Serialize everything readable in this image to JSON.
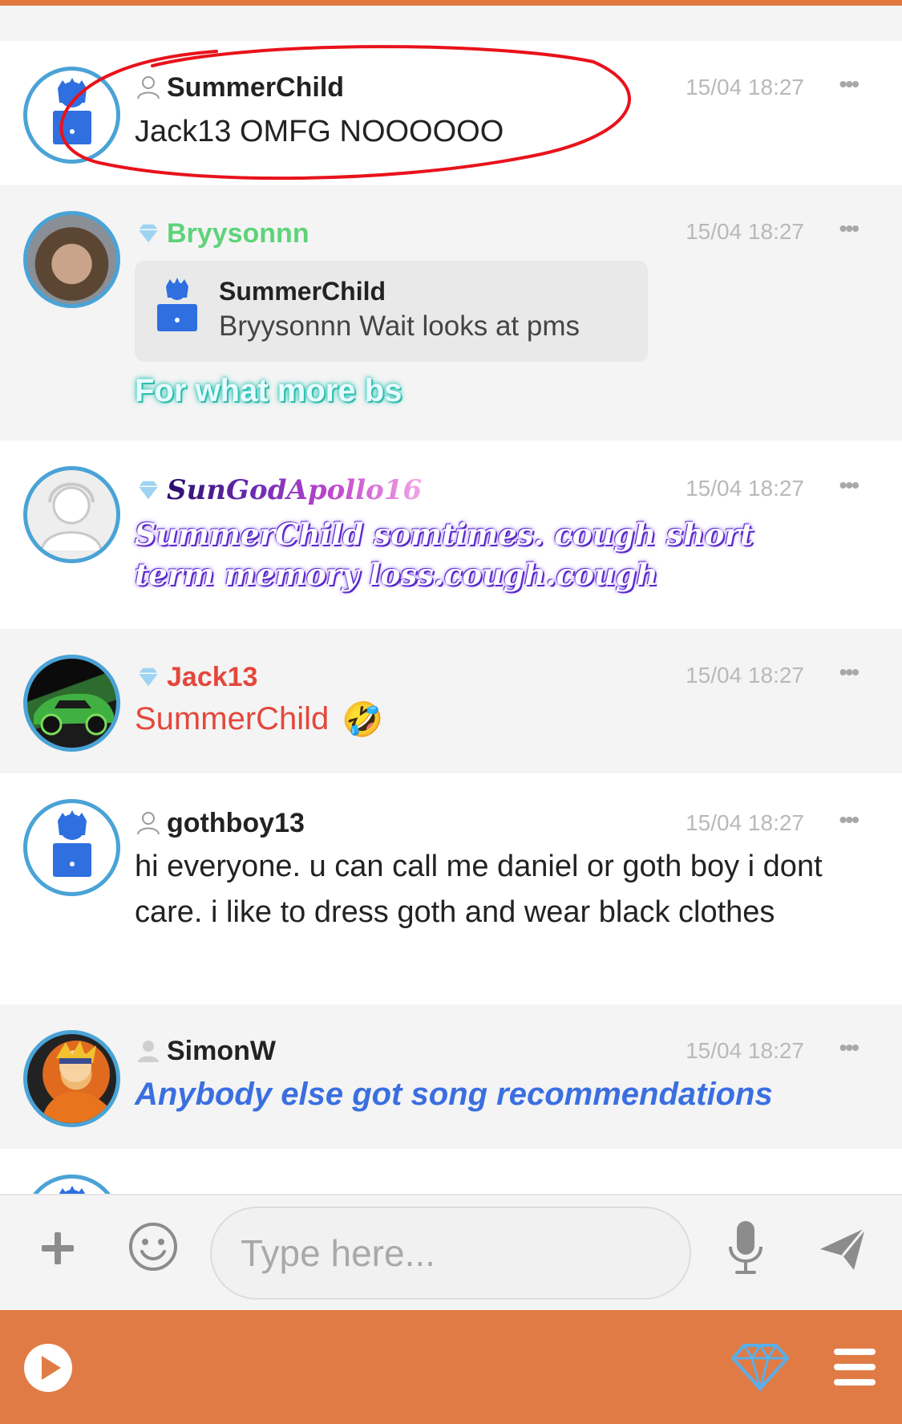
{
  "colors": {
    "accent_orange": "#e07b45",
    "avatar_ring": "#4aa3d6",
    "default_avatar_blue": "#2f6fe0",
    "timestamp_grey": "#b9b9b9",
    "annotation_red": "#e8121b"
  },
  "messages": [
    {
      "user": "SummerChild",
      "user_color": "#222222",
      "role_icon": "person-outline-icon",
      "avatar": "default-avatar-icon",
      "time": "15/04 18:27",
      "more": "•••",
      "text": "Jack13 OMFG NOOOOOO"
    },
    {
      "user": "Bryysonnn",
      "user_color": "#5ed37a",
      "role_icon": "diamond-icon",
      "avatar": "photo-avatar",
      "time": "15/04 18:27",
      "more": "•••",
      "quote": {
        "user": "SummerChild",
        "text": "Bryysonnn Wait looks at pms"
      },
      "text": "For what more bs"
    },
    {
      "user": "SunGodApollo16",
      "user_color": "#4a1a8c",
      "role_icon": "diamond-icon",
      "avatar": "silhouette-avatar",
      "time": "15/04 18:27",
      "more": "•••",
      "text": "SummerChild somtimes. cough short term memory loss.cough.cough"
    },
    {
      "user": "Jack13",
      "user_color": "#e4473c",
      "role_icon": "diamond-icon",
      "avatar": "car-avatar",
      "time": "15/04 18:27",
      "more": "•••",
      "text": "SummerChild",
      "emoji": "🤣"
    },
    {
      "user": "gothboy13",
      "user_color": "#222222",
      "role_icon": "person-outline-icon",
      "avatar": "default-avatar-icon",
      "time": "15/04 18:27",
      "more": "•••",
      "text": "hi everyone. u can call me daniel or goth boy i dont care. i like to dress goth and wear black clothes"
    },
    {
      "user": "SimonW",
      "user_color": "#222222",
      "role_icon": "person-solid-icon",
      "avatar": "anime-avatar",
      "time": "15/04 18:27",
      "more": "•••",
      "text": "Anybody else got song recommendations"
    }
  ],
  "composer": {
    "placeholder": "Type here...",
    "value": ""
  }
}
